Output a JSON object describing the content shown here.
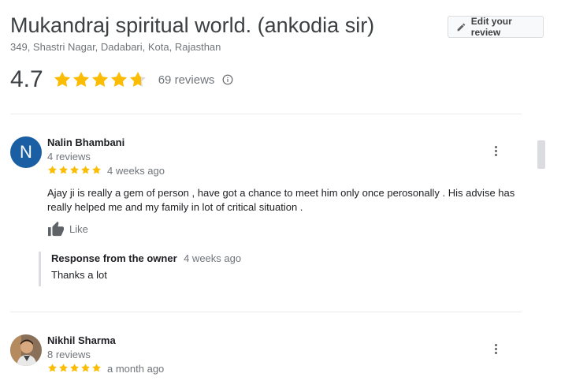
{
  "place": {
    "name": "Mukandraj spiritual world. (ankodia sir)",
    "address": "349, Shastri Nagar, Dadabari, Kota, Rajasthan",
    "rating": "4.7",
    "rating_value": 4.7,
    "reviews_count": "69 reviews"
  },
  "toolbar": {
    "edit_label": "Edit your review"
  },
  "colors": {
    "star": "#fbbc04",
    "avatar_n": "#1a5fa3"
  },
  "reviews": [
    {
      "avatar_letter": "N",
      "name": "Nalin Bhambani",
      "review_count": "4 reviews",
      "stars": 5,
      "time": "4 weeks ago",
      "text": "Ajay ji is really a gem of person , have got a chance to meet him only once perosonally . His advise has really helped me and my family in lot of critical situation .",
      "like_label": "Like",
      "owner_response": {
        "label": "Response from the owner",
        "time": "4 weeks ago",
        "text": "Thanks a lot"
      }
    },
    {
      "name": "Nikhil Sharma",
      "review_count": "8 reviews",
      "stars": 5,
      "time": "a month ago"
    }
  ]
}
